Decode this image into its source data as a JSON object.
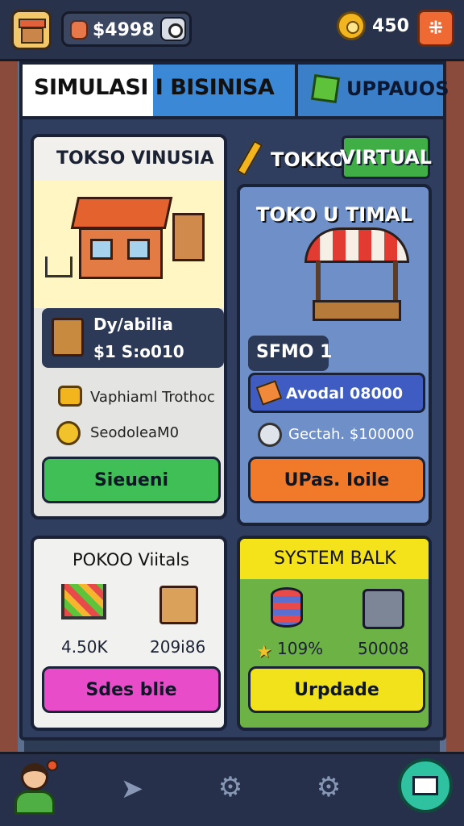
{
  "topbar": {
    "coins": "$4998",
    "gems": "450"
  },
  "header": {
    "title": "SIMULASI I BISINISA",
    "upgrade_label": "UPPAUOS"
  },
  "card_a": {
    "title": "TOKSO VINUSIA",
    "item_name": "Dy/abilia",
    "item_price": "$1 S:o010",
    "stat1": "Vaphiaml Trothoc",
    "stat2": "SeodoleaM0",
    "button": "Sieueni"
  },
  "card_b": {
    "title_left": "TOKKO",
    "title_right": "VIRTUAL",
    "subtitle": "TOKO U TIMAL",
    "level": "SFMO 1",
    "stat1": "Avodal 08000",
    "stat2": "Gectah. $100000",
    "button": "UPas. Ioile"
  },
  "card_c": {
    "title": "POKOO Viitals",
    "value1": "4.50K",
    "value2": "209i86",
    "button": "Sdes blie"
  },
  "card_d": {
    "title": "SYSTEM BALK",
    "value1": "109%",
    "value2": "50008",
    "button": "Urpdade"
  },
  "icons": {
    "menu": "grid-icon",
    "nav": [
      "avatar",
      "location-pin-icon",
      "settings-icon",
      "gear-icon",
      "mail-icon"
    ]
  },
  "colors": {
    "green_button": "#3fbf55",
    "orange_button": "#f07a2a",
    "pink_button": "#e94cc8",
    "yellow_button": "#f2e21c",
    "header_blue": "#3b89d6"
  }
}
